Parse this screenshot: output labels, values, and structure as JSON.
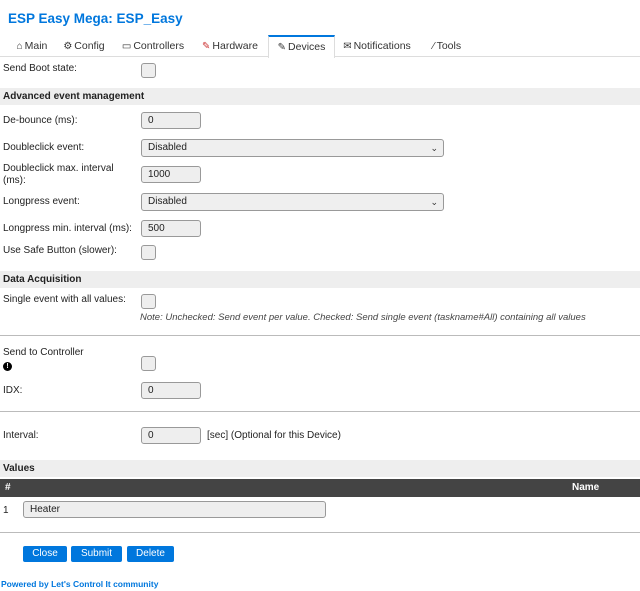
{
  "app": {
    "title": "ESP Easy Mega: ESP_Easy"
  },
  "tabs": [
    {
      "label": "Main",
      "icon": "⌂"
    },
    {
      "label": "Config",
      "icon": "⚙"
    },
    {
      "label": "Controllers",
      "icon": "💬"
    },
    {
      "label": "Hardware",
      "icon": "📌"
    },
    {
      "label": "Devices",
      "icon": "🔌"
    },
    {
      "label": "Notifications",
      "icon": "✉"
    },
    {
      "label": "Tools",
      "icon": "🔧"
    }
  ],
  "form": {
    "send_boot_state": {
      "label": "Send Boot state:",
      "checked": false
    },
    "advanced_section": "Advanced event management",
    "debounce": {
      "label": "De-bounce (ms):",
      "value": "0"
    },
    "doubleclick_event": {
      "label": "Doubleclick event:",
      "value": "Disabled"
    },
    "doubleclick_interval": {
      "label": "Doubleclick max. interval (ms):",
      "value": "1000"
    },
    "longpress_event": {
      "label": "Longpress event:",
      "value": "Disabled"
    },
    "longpress_interval": {
      "label": "Longpress min. interval (ms):",
      "value": "500"
    },
    "safe_button": {
      "label": "Use Safe Button (slower):",
      "checked": false
    },
    "data_section": "Data Acquisition",
    "single_event": {
      "label": "Single event with all values:",
      "checked": false
    },
    "single_event_note": "Note: Unchecked: Send event per value. Checked: Send single event (taskname#All) containing all values",
    "send_to_controller": {
      "label": "Send to Controller",
      "checked": false
    },
    "idx": {
      "label": "IDX:",
      "value": "0"
    },
    "interval": {
      "label": "Interval:",
      "value": "0",
      "suffix": "[sec] (Optional for this Device)"
    },
    "values_section": "Values"
  },
  "values_table": {
    "headers": {
      "num": "#",
      "name": "Name"
    },
    "rows": [
      {
        "num": "1",
        "name": "Heater"
      }
    ]
  },
  "buttons": {
    "close": "Close",
    "submit": "Submit",
    "delete": "Delete"
  },
  "footer": {
    "prefix": "Powered by ",
    "link": "Let's Control It",
    "suffix": " community"
  },
  "colors": {
    "accent": "#0077dd",
    "section_bg": "#eeeeee",
    "table_head": "#444444"
  }
}
